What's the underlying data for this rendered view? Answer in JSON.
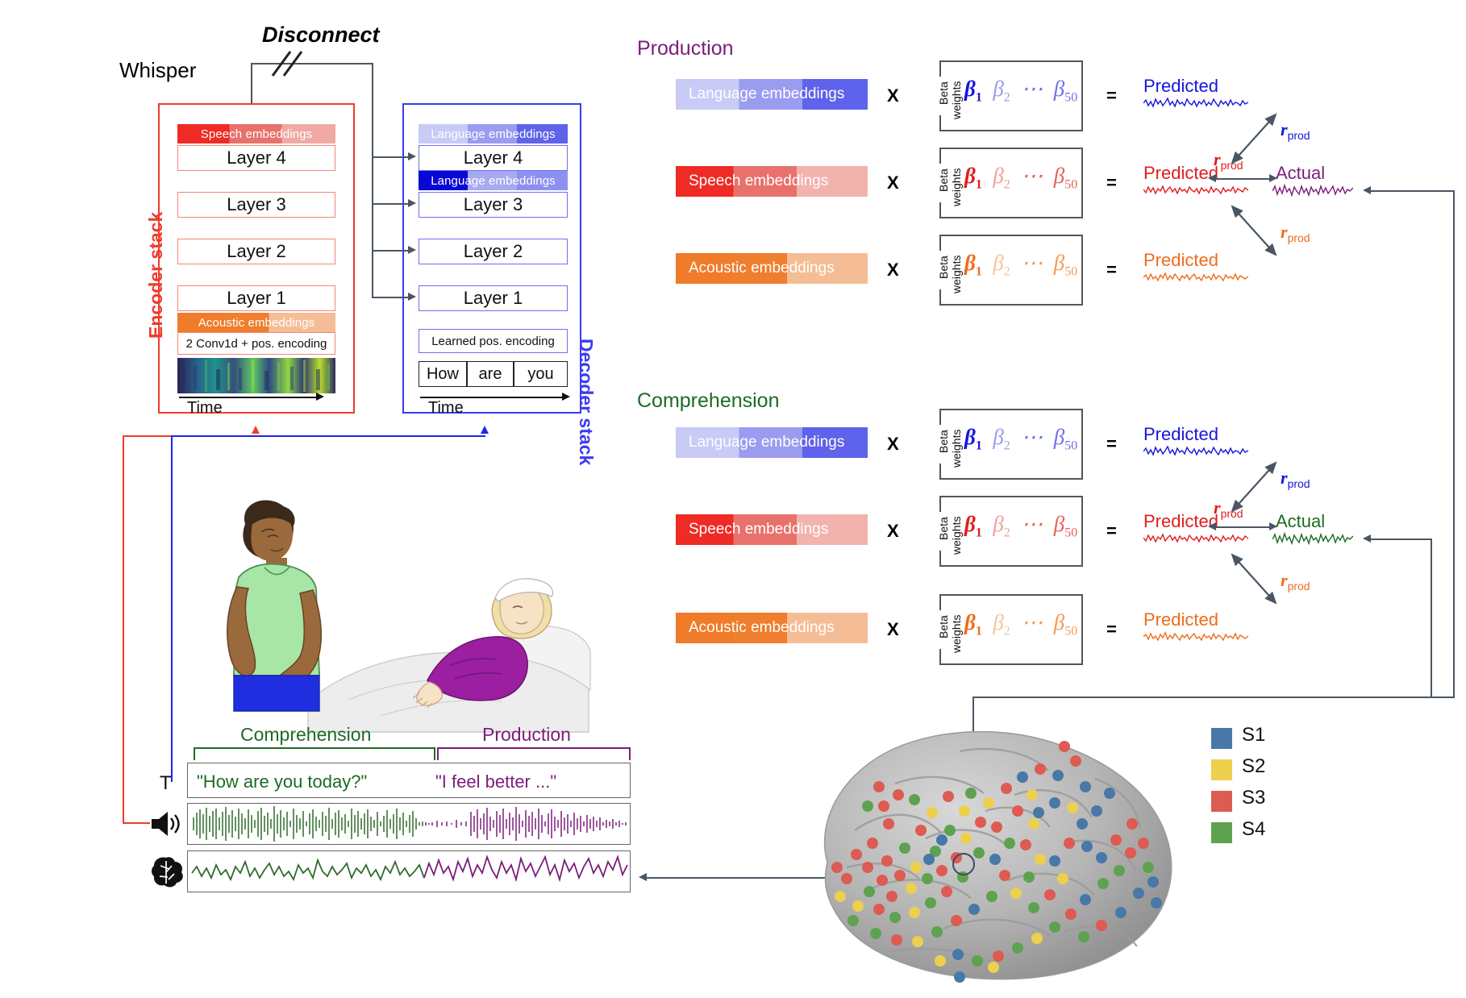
{
  "model": {
    "name": "Whisper",
    "disconnect_label": "Disconnect",
    "encoder_stack_label": "Encoder stack",
    "decoder_stack_label": "Decoder stack",
    "encoder": {
      "speech_embeddings_chip": "Speech embeddings",
      "acoustic_embeddings_chip": "Acoustic embeddings",
      "conv_label": "2 Conv1d + pos. encoding",
      "time_label": "Time",
      "layers": [
        "Layer 4",
        "Layer 3",
        "Layer 2",
        "Layer 1"
      ]
    },
    "decoder": {
      "language_embeddings_chip_top": "Language embeddings",
      "language_embeddings_chip_mid": "Language embeddings",
      "learned_pos_label": "Learned pos. encoding",
      "time_label": "Time",
      "layers": [
        "Layer 4",
        "Layer 3",
        "Layer 2",
        "Layer 1"
      ],
      "tokens": [
        "How",
        "are",
        "you"
      ]
    }
  },
  "analysis": {
    "production": {
      "title": "Production",
      "actual_label": "Actual",
      "actual_color": "#7b1e7a",
      "rows": [
        {
          "embedding": "Language embeddings",
          "times": "X",
          "beta_label_1": "Beta",
          "beta_label_2": "weights",
          "beta_terms": [
            "β",
            "1",
            "β",
            "2",
            "⋯",
            "β",
            "50"
          ],
          "equals": "=",
          "predicted": "Predicted",
          "color": "#1515e0",
          "r_label": "r",
          "r_sub": "prod"
        },
        {
          "embedding": "Speech embeddings",
          "times": "X",
          "beta_label_1": "Beta",
          "beta_label_2": "weights",
          "beta_terms": [
            "β",
            "1",
            "β",
            "2",
            "⋯",
            "β",
            "50"
          ],
          "equals": "=",
          "predicted": "Predicted",
          "color": "#e11d1d",
          "r_label": "r",
          "r_sub": "prod"
        },
        {
          "embedding": "Acoustic embeddings",
          "times": "X",
          "beta_label_1": "Beta",
          "beta_label_2": "weights",
          "beta_terms": [
            "β",
            "1",
            "β",
            "2",
            "⋯",
            "β",
            "50"
          ],
          "equals": "=",
          "predicted": "Predicted",
          "color": "#ef6c1a",
          "r_label": "r",
          "r_sub": "prod"
        }
      ]
    },
    "comprehension": {
      "title": "Comprehension",
      "actual_label": "Actual",
      "actual_color": "#1d6b24",
      "rows": [
        {
          "embedding": "Language embeddings",
          "times": "X",
          "beta_label_1": "Beta",
          "beta_label_2": "weights",
          "beta_terms": [
            "β",
            "1",
            "β",
            "2",
            "⋯",
            "β",
            "50"
          ],
          "equals": "=",
          "predicted": "Predicted",
          "color": "#1515e0",
          "r_label": "r",
          "r_sub": "prod"
        },
        {
          "embedding": "Speech embeddings",
          "times": "X",
          "beta_label_1": "Beta",
          "beta_label_2": "weights",
          "beta_terms": [
            "β",
            "1",
            "β",
            "2",
            "⋯",
            "β",
            "50"
          ],
          "equals": "=",
          "predicted": "Predicted",
          "color": "#e11d1d",
          "r_label": "r",
          "r_sub": "prod"
        },
        {
          "embedding": "Acoustic embeddings",
          "times": "X",
          "beta_label_1": "Beta",
          "beta_label_2": "weights",
          "beta_terms": [
            "β",
            "1",
            "β",
            "2",
            "⋯",
            "β",
            "50"
          ],
          "equals": "=",
          "predicted": "Predicted",
          "color": "#ef6c1a",
          "r_label": "r",
          "r_sub": "prod"
        }
      ]
    }
  },
  "conversation": {
    "comprehension_bracket": "Comprehension",
    "production_bracket": "Production",
    "transcript_icon": "T",
    "audio_icon": "speaker-icon",
    "brain_icon": "brain-icon",
    "comprehension_quote": "\"How are you today?\"",
    "production_quote": "\"I feel better ...\"",
    "comprehension_color": "#1d6b24",
    "production_color": "#7b1e7a"
  },
  "brain": {
    "legend": [
      {
        "label": "S1",
        "color": "#4878a8"
      },
      {
        "label": "S2",
        "color": "#ecd04e"
      },
      {
        "label": "S3",
        "color": "#dd5b52"
      },
      {
        "label": "S4",
        "color": "#5ea250"
      }
    ]
  },
  "colors": {
    "encoder_red": "#ef3b2c",
    "decoder_blue": "#3b3bf0",
    "arrow_gray": "#4a5663",
    "speech_red": "#ee2b24",
    "acoustic_orange": "#f07b28",
    "language_blue": "#5f62ea"
  }
}
